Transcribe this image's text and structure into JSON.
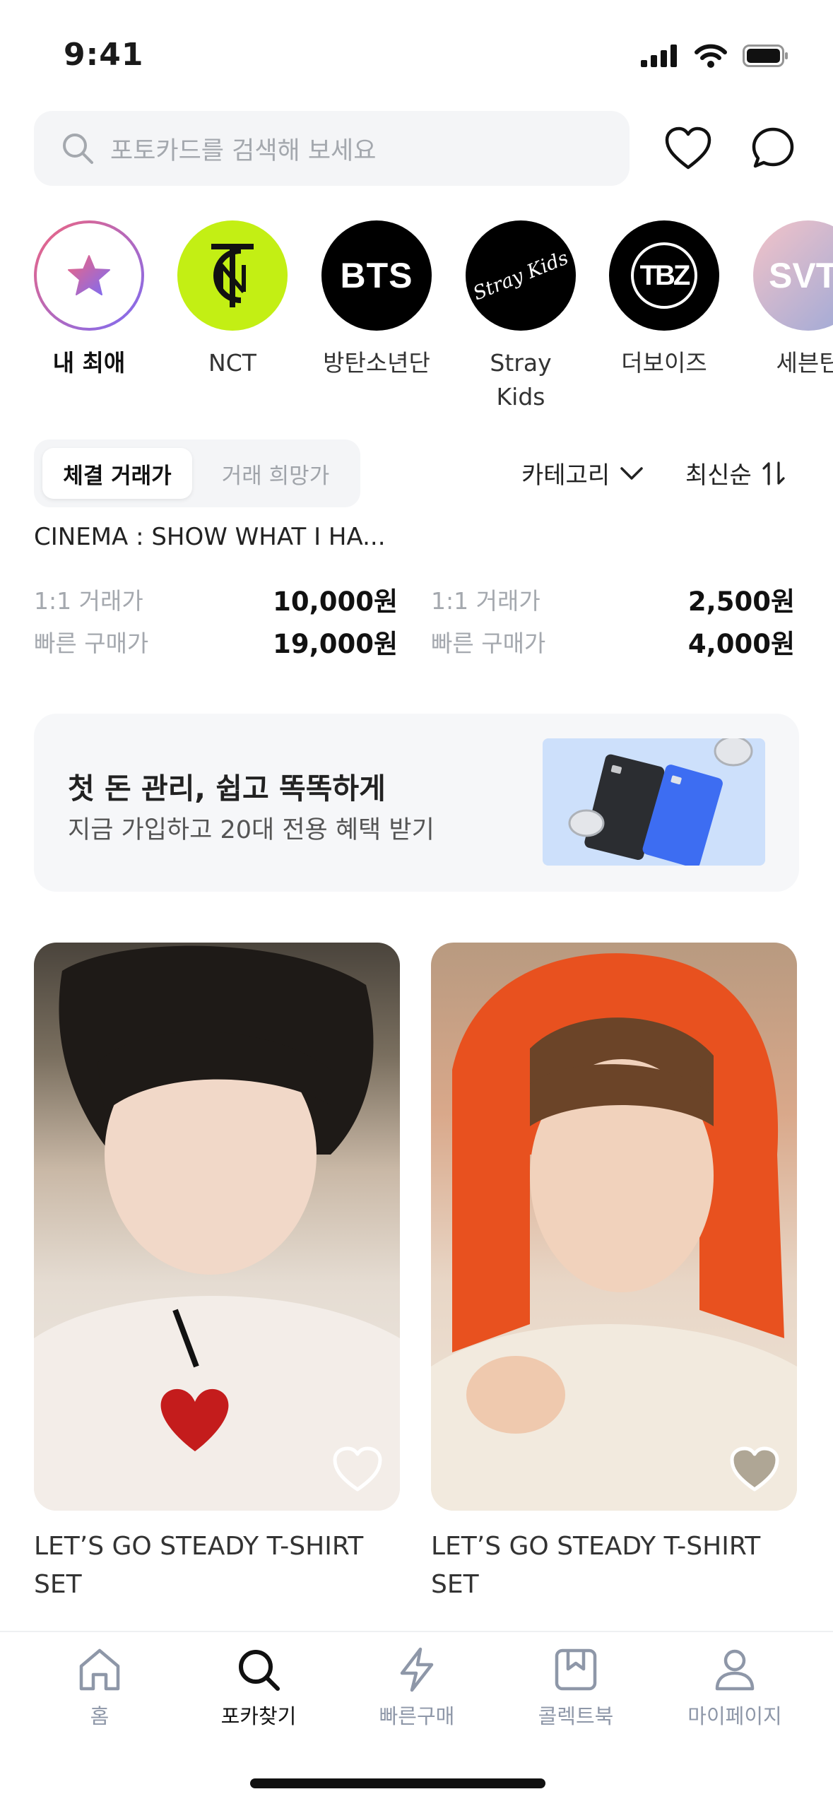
{
  "status_bar": {
    "time": "9:41"
  },
  "search": {
    "placeholder": "포토카드를 검색해 보세요"
  },
  "artists": [
    {
      "name": "내 최애",
      "icon": "star-icon"
    },
    {
      "name": "NCT",
      "logo_text": "NCT"
    },
    {
      "name": "방탄소년단",
      "logo_text": "BTS"
    },
    {
      "name": "Stray Kids",
      "logo_text": "Stray Kids"
    },
    {
      "name": "더보이즈",
      "logo_text": "TBZ"
    },
    {
      "name": "세븐틴",
      "logo_text": "SVT"
    }
  ],
  "filters": {
    "segments": [
      "체결 거래가",
      "거래 희망가"
    ],
    "category_label": "카테고리",
    "sort_label": "최신순"
  },
  "listing": {
    "title": "CINEMA : SHOW WHAT I HA...",
    "columns": [
      {
        "one_to_one_label": "1:1 거래가",
        "one_to_one_value": "10,000원",
        "quick_label": "빠른 구매가",
        "quick_value": "19,000원"
      },
      {
        "one_to_one_label": "1:1 거래가",
        "one_to_one_value": "2,500원",
        "quick_label": "빠른 구매가",
        "quick_value": "4,000원"
      }
    ]
  },
  "banner": {
    "title": "첫 돈 관리, 쉽고 똑똑하게",
    "subtitle": "지금 가입하고 20대 전용 혜택 받기"
  },
  "products": [
    {
      "title": "LET’S GO STEADY T-SHIRT SET"
    },
    {
      "title": "LET’S GO STEADY T-SHIRT SET"
    }
  ],
  "tabs": [
    {
      "label": "홈",
      "icon": "home-icon"
    },
    {
      "label": "포카찾기",
      "icon": "search-icon"
    },
    {
      "label": "빠른구매",
      "icon": "lightning-icon"
    },
    {
      "label": "콜렉트북",
      "icon": "bookmark-book-icon"
    },
    {
      "label": "마이페이지",
      "icon": "user-icon"
    }
  ],
  "colors": {
    "accent_gradient_start": "#f0657f",
    "accent_gradient_end": "#7b6cf6",
    "nct_green": "#c3ef14",
    "tab_inactive": "#8e97a8"
  }
}
